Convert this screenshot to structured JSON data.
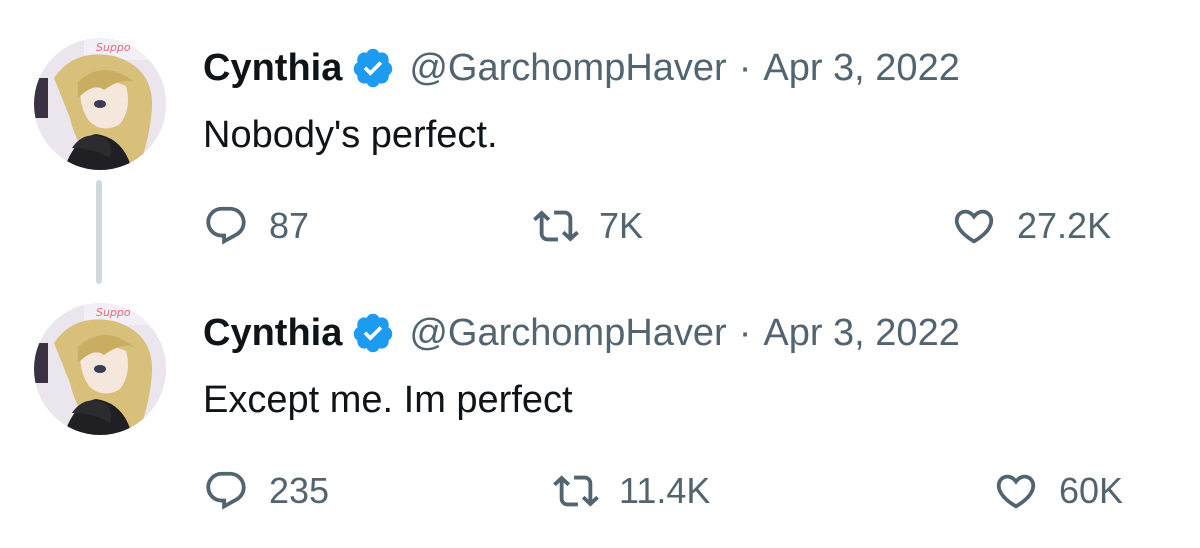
{
  "tweets": [
    {
      "author_name": "Cynthia",
      "handle": "@GarchompHaver",
      "separator": "·",
      "date": "Apr 3, 2022",
      "text": "Nobody's perfect.",
      "replies": "87",
      "retweets": "7K",
      "likes": "27.2K",
      "avatar_badge_text": "Suppo"
    },
    {
      "author_name": "Cynthia",
      "handle": "@GarchompHaver",
      "separator": "·",
      "date": "Apr 3, 2022",
      "text": "Except me. Im perfect",
      "replies": "235",
      "retweets": "11.4K",
      "likes": "60K",
      "avatar_badge_text": "Suppo"
    }
  ],
  "icons": {
    "verified": "verified-badge-icon",
    "reply": "reply-icon",
    "retweet": "retweet-icon",
    "like": "heart-icon"
  },
  "colors": {
    "verified_blue": "#1d9bf0",
    "text_primary": "#0f1419",
    "text_secondary": "#536471",
    "thread_line": "#cfd9de"
  }
}
